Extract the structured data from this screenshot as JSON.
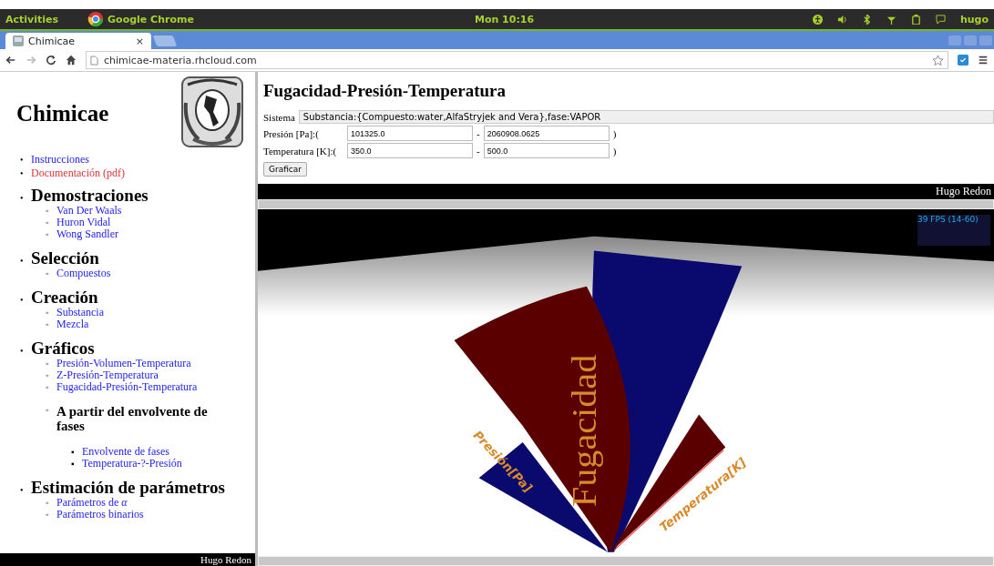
{
  "top_bar": {
    "activities": "Activities",
    "app": "Google Chrome",
    "clock": "Mon 10:16",
    "user": "hugo"
  },
  "browser": {
    "tab": {
      "title": "Chimicae",
      "close": "×",
      "selected": true
    },
    "url": "chimicae-materia.rhcloud.com"
  },
  "sidebar": {
    "title": "Chimicae",
    "markers": [
      "•",
      "◦",
      "▪"
    ],
    "links": [
      {
        "label": "Instrucciones",
        "color": "#2222ee"
      },
      {
        "label": "Documentación (pdf)",
        "color": "#e03333"
      }
    ],
    "sections": [
      {
        "heading": "Demostraciones",
        "items": [
          {
            "kind": "link",
            "label": "Van Der Waals"
          },
          {
            "kind": "link",
            "label": "Huron Vidal"
          },
          {
            "kind": "link",
            "label": "Wong Sandler"
          }
        ]
      },
      {
        "heading": "Selección",
        "items": [
          {
            "kind": "link",
            "label": "Compuestos"
          }
        ]
      },
      {
        "heading": "Creación",
        "items": [
          {
            "kind": "link",
            "label": "Substancia"
          },
          {
            "kind": "link",
            "label": "Mezcla"
          }
        ]
      },
      {
        "heading": "Gráficos",
        "items": [
          {
            "kind": "link",
            "label": "Presión-Volumen-Temperatura"
          },
          {
            "kind": "link",
            "label": "Z-Presión-Temperatura"
          },
          {
            "kind": "link",
            "label": "Fugacidad-Presión-Temperatura"
          },
          {
            "kind": "heading",
            "label": "A partir del envolvente de fases",
            "children": [
              {
                "kind": "link",
                "label": "Envolvente de fases"
              },
              {
                "kind": "link",
                "label": "Temperatura-?-Presión"
              }
            ]
          }
        ]
      },
      {
        "heading": "Estimación de parámetros",
        "items": [
          {
            "kind": "link",
            "label": "Parámetros de *α*"
          },
          {
            "kind": "link",
            "label": "Parámetros binarios"
          }
        ]
      }
    ],
    "footer": "Hugo Redon"
  },
  "main": {
    "title": "Fugacidad-Presión-Temperatura",
    "sistema": {
      "label": "Sistema",
      "value": "Substancia:{Compuesto:water,AlfaStryjek and Vera},fase:VAPOR"
    },
    "ranges": [
      {
        "label": "Presión [Pa]:(",
        "from": "101325.0",
        "separator": "-",
        "to": "2060908.0625",
        "close": ")"
      },
      {
        "label": "Temperatura [K]:(",
        "from": "350.0",
        "separator": "-",
        "to": "500.0",
        "close": ")"
      }
    ],
    "button": "Graficar",
    "banner": "Hugo Redon",
    "plot": {
      "fps": "39 FPS (14-60)",
      "z_label": "Fugacidad",
      "x_label": "Presión[Pa]",
      "y_label": "Temperatura[K]"
    }
  }
}
